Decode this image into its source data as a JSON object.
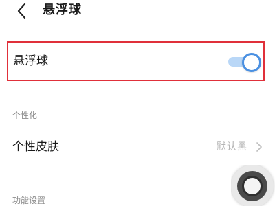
{
  "header": {
    "back_icon": "chevron-left-icon",
    "title": "悬浮球"
  },
  "float_ball_setting": {
    "label": "悬浮球",
    "enabled": true,
    "accent_color": "#4a90e2",
    "highlight_color": "#e0303a"
  },
  "personalization": {
    "section_title": "个性化",
    "skin": {
      "label": "个性皮肤",
      "value": "默认黑",
      "chevron_icon": "chevron-right-icon"
    }
  },
  "function_settings": {
    "section_title": "功能设置"
  },
  "overlay": {
    "icon": "floating-ball-icon"
  }
}
